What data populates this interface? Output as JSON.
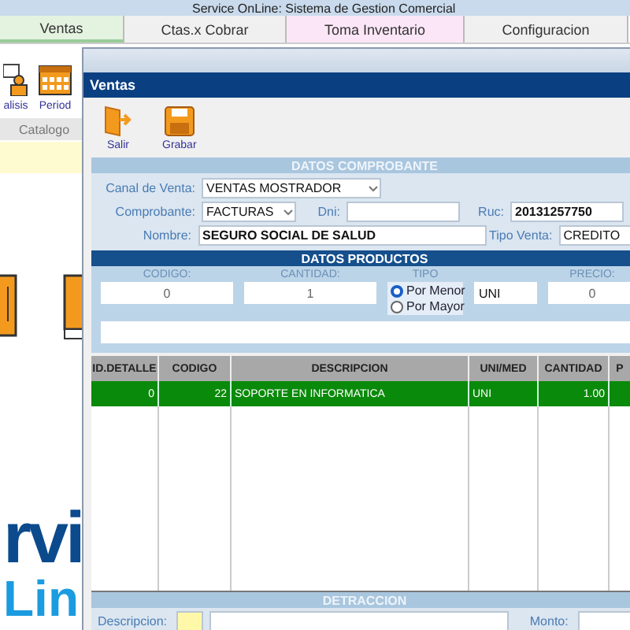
{
  "app": {
    "title": "Service OnLine: Sistema de  Gestion Comercial"
  },
  "tabs": [
    {
      "label": "Ventas",
      "selected": true,
      "color": "#e4f3e0"
    },
    {
      "label": "Ctas.x Cobrar",
      "selected": false,
      "color": "#f0f0f0"
    },
    {
      "label": "Toma  Inventario",
      "selected": false,
      "color": "#fbe6f7"
    },
    {
      "label": "Configuracion",
      "selected": false,
      "color": "#f0f0f0"
    }
  ],
  "toolbar": [
    {
      "label": "alisis",
      "kind": "analysis"
    },
    {
      "label": "Period",
      "kind": "calendar"
    }
  ],
  "catalog_label": "Catalogo",
  "logo": {
    "line1": "rvi",
    "line2": "Lin"
  },
  "dialog": {
    "title": "Ventas",
    "toolbar": [
      {
        "label": "Salir",
        "kind": "exit"
      },
      {
        "label": "Grabar",
        "kind": "save"
      }
    ],
    "comprobante": {
      "header": "DATOS COMPROBANTE",
      "canal_label": "Canal de Venta:",
      "canal_value": "VENTAS MOSTRADOR",
      "comprobante_label": "Comprobante:",
      "comprobante_value": "FACTURAS",
      "dni_label": "Dni:",
      "ruc_label": "Ruc:",
      "ruc_value": "20131257750",
      "nombre_label": "Nombre:",
      "nombre_value": "SEGURO SOCIAL DE SALUD",
      "tipo_venta_label": "Tipo Venta:",
      "tipo_venta_value": "CREDITO"
    },
    "productos": {
      "header": "DATOS PRODUCTOS",
      "codigo_label": "CODIGO:",
      "codigo_value": "0",
      "cantidad_label": "CANTIDAD:",
      "cantidad_value": "1",
      "tipo_label": "TIPO",
      "tipo_options": [
        {
          "label": "Por Menor",
          "selected": true
        },
        {
          "label": "Por Mayor",
          "selected": false
        }
      ],
      "unidad_value": "UNI",
      "precio_label": "PRECIO:",
      "precio_value": "0"
    },
    "table": {
      "columns": [
        "ID.DETALLE",
        "CODIGO",
        "DESCRIPCION",
        "UNI/MED",
        "CANTIDAD",
        "P"
      ],
      "rows": [
        {
          "cells": [
            "0",
            "22",
            "SOPORTE EN INFORMATICA",
            "UNI",
            "1.00"
          ],
          "selected": true
        }
      ]
    },
    "detraccion": {
      "header": "DETRACCION",
      "descripcion_label": "Descripcion:",
      "monto_label": "Monto:"
    }
  }
}
